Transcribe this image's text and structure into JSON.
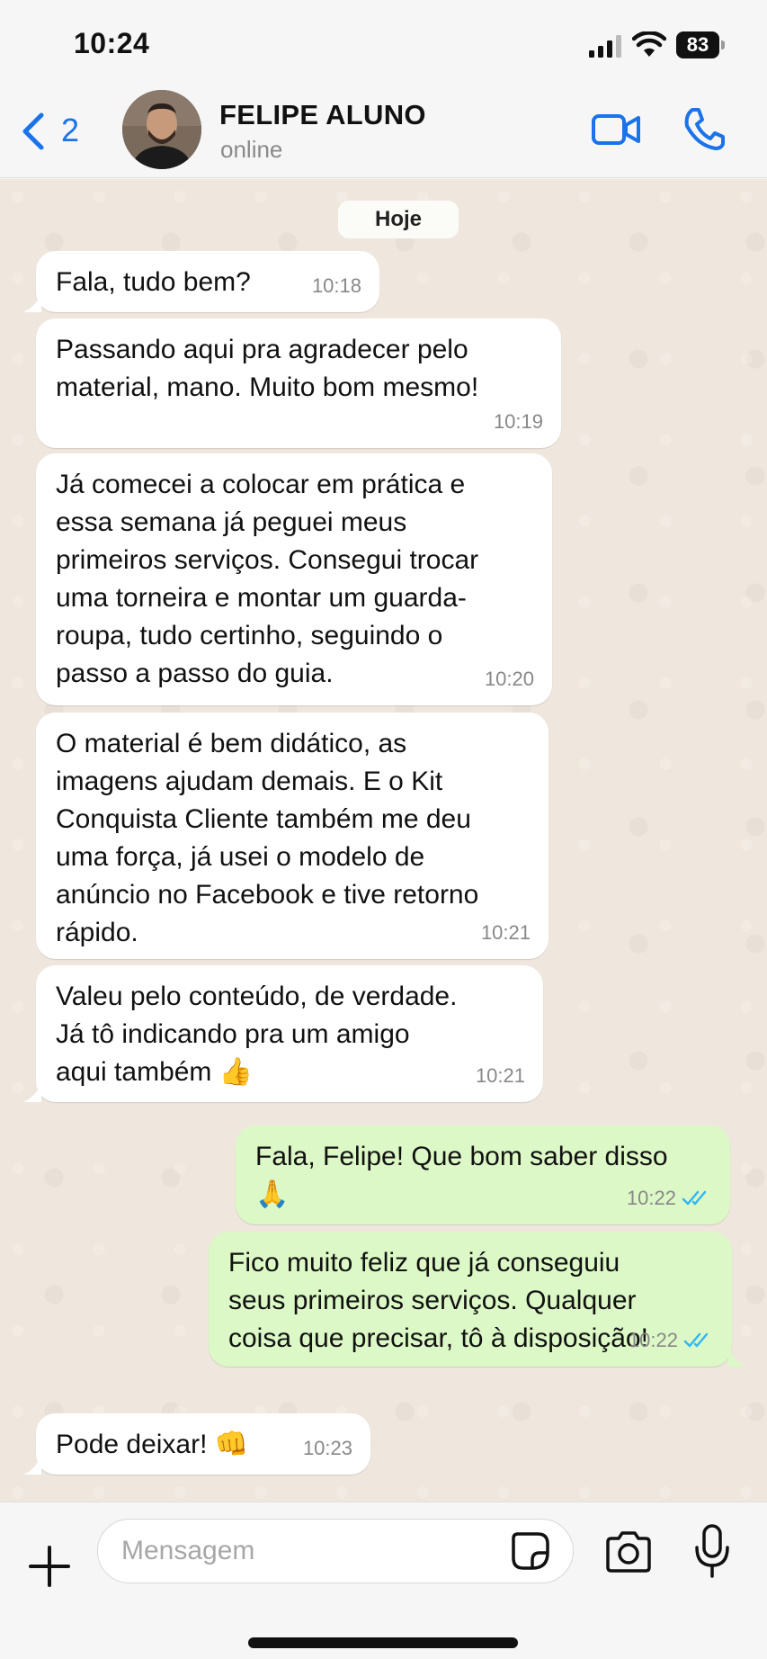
{
  "status_bar": {
    "time": "10:24",
    "battery": "83"
  },
  "header": {
    "back_count": "2",
    "contact_name": "FELIPE ALUNO",
    "contact_status": "online"
  },
  "chat": {
    "date_chip": "Hoje",
    "messages": [
      {
        "dir": "in",
        "text": "Fala, tudo bem?",
        "time": "10:18"
      },
      {
        "dir": "in",
        "text": "Passando aqui pra agradecer pelo\nmaterial, mano. Muito bom mesmo!",
        "time": "10:19"
      },
      {
        "dir": "in",
        "text": "Já comecei a colocar em prática e\nessa semana já peguei meus\nprimeiros serviços. Consegui trocar\numa torneira e montar um guarda-\nroupa, tudo certinho, seguindo o\npasso a passo do guia.",
        "time": "10:20"
      },
      {
        "dir": "in",
        "text": "O material é bem didático, as\nimagens ajudam demais. E o Kit\nConquista Cliente também me deu\numa força, já usei o modelo de\nanúncio no Facebook e tive retorno\nrápido.",
        "time": "10:21"
      },
      {
        "dir": "in",
        "text": "Valeu pelo conteúdo, de verdade.\nJá tô indicando pra um amigo\naqui também 👍",
        "time": "10:21"
      },
      {
        "dir": "out",
        "text": "Fala, Felipe! Que bom saber disso\n🙏",
        "time": "10:22"
      },
      {
        "dir": "out",
        "text": "Fico muito feliz que já conseguiu\nseus primeiros serviços. Qualquer\ncoisa que precisar, tô à disposição!",
        "time": "10:22"
      },
      {
        "dir": "in",
        "text": "Pode deixar! 👊",
        "time": "10:23"
      }
    ]
  },
  "input": {
    "placeholder": "Mensagem"
  },
  "colors": {
    "accent": "#1a73e8",
    "incoming": "#ffffff",
    "outgoing": "#dcf8c6",
    "chat_bg": "#efe7de",
    "read_ticks": "#34b7f1"
  },
  "icons": [
    "signal-icon",
    "wifi-icon",
    "battery-icon",
    "back-chevron-icon",
    "video-call-icon",
    "phone-icon",
    "plus-icon",
    "sticker-icon",
    "camera-icon",
    "microphone-icon",
    "double-check-icon"
  ]
}
